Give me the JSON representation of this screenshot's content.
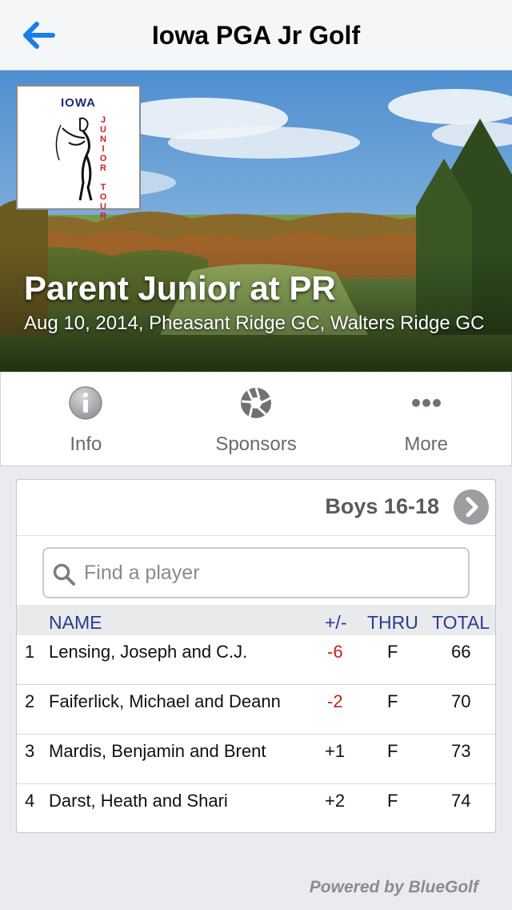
{
  "navbar": {
    "title": "Iowa PGA Jr Golf",
    "back_icon": "back-arrow-icon",
    "accent": "#1a7ee6"
  },
  "hero": {
    "logo": {
      "top_text": "IOWA",
      "side_text": "JUNIOR TOUR"
    },
    "title": "Parent Junior at PR",
    "subtitle": "Aug 10, 2014, Pheasant Ridge GC, Walters Ridge GC"
  },
  "tabs": [
    {
      "label": "Info",
      "icon": "info-icon"
    },
    {
      "label": "Sponsors",
      "icon": "aperture-icon"
    },
    {
      "label": "More",
      "icon": "more-dots-icon"
    }
  ],
  "leaderboard": {
    "division": "Boys 16-18",
    "search_placeholder": "Find a player",
    "columns": {
      "name": "NAME",
      "to_par": "+/-",
      "thru": "THRU",
      "total": "TOTAL"
    },
    "rows": [
      {
        "pos": "1",
        "name": "Lensing, Joseph and C.J.",
        "to_par": "-6",
        "thru": "F",
        "total": "66"
      },
      {
        "pos": "2",
        "name": "Faiferlick, Michael and Deann",
        "to_par": "-2",
        "thru": "F",
        "total": "70"
      },
      {
        "pos": "3",
        "name": "Mardis, Benjamin and Brent",
        "to_par": "+1",
        "thru": "F",
        "total": "73"
      },
      {
        "pos": "4",
        "name": "Darst, Heath and Shari",
        "to_par": "+2",
        "thru": "F",
        "total": "74"
      }
    ],
    "under_par_color": "#c0201c"
  },
  "footer": "Powered by BlueGolf"
}
